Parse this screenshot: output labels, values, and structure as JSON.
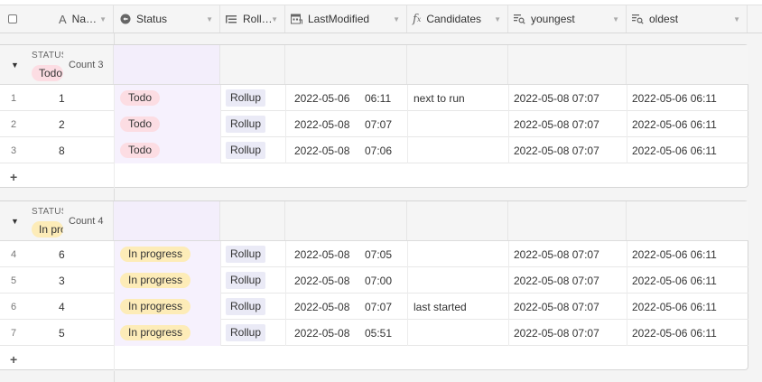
{
  "colors": {
    "todo": "#fcdde3",
    "in_progress": "#fdecb8",
    "rollup_bg": "#eaeaf6",
    "status_col_bg": "#f6f1fd"
  },
  "columns": [
    {
      "label": "Na…",
      "icon": "text-icon"
    },
    {
      "label": "Status",
      "icon": "status-icon"
    },
    {
      "label": "Roll…",
      "icon": "rollup-icon"
    },
    {
      "label": "LastModified",
      "icon": "calendar-icon"
    },
    {
      "label": "Candidates",
      "icon": "formula-icon"
    },
    {
      "label": "youngest",
      "icon": "lookup-icon"
    },
    {
      "label": "oldest",
      "icon": "lookup-icon"
    }
  ],
  "groups": [
    {
      "field_label": "STATUS",
      "value": "Todo",
      "count": "Count 3",
      "rows": [
        {
          "num": "1",
          "name": "1",
          "status": "Todo",
          "rollup": "Rollup",
          "date": "2022-05-06",
          "time": "06:11",
          "candidates": "next to run",
          "youngest": "2022-05-08 07:07",
          "oldest": "2022-05-06 06:11"
        },
        {
          "num": "2",
          "name": "2",
          "status": "Todo",
          "rollup": "Rollup",
          "date": "2022-05-08",
          "time": "07:07",
          "candidates": "",
          "youngest": "2022-05-08 07:07",
          "oldest": "2022-05-06 06:11"
        },
        {
          "num": "3",
          "name": "8",
          "status": "Todo",
          "rollup": "Rollup",
          "date": "2022-05-08",
          "time": "07:06",
          "candidates": "",
          "youngest": "2022-05-08 07:07",
          "oldest": "2022-05-06 06:11"
        }
      ]
    },
    {
      "field_label": "STATUS",
      "value": "In progress",
      "count": "Count 4",
      "rows": [
        {
          "num": "4",
          "name": "6",
          "status": "In progress",
          "rollup": "Rollup",
          "date": "2022-05-08",
          "time": "07:05",
          "candidates": "",
          "youngest": "2022-05-08 07:07",
          "oldest": "2022-05-06 06:11"
        },
        {
          "num": "5",
          "name": "3",
          "status": "In progress",
          "rollup": "Rollup",
          "date": "2022-05-08",
          "time": "07:00",
          "candidates": "",
          "youngest": "2022-05-08 07:07",
          "oldest": "2022-05-06 06:11"
        },
        {
          "num": "6",
          "name": "4",
          "status": "In progress",
          "rollup": "Rollup",
          "date": "2022-05-08",
          "time": "07:07",
          "candidates": "last started",
          "youngest": "2022-05-08 07:07",
          "oldest": "2022-05-06 06:11"
        },
        {
          "num": "7",
          "name": "5",
          "status": "In progress",
          "rollup": "Rollup",
          "date": "2022-05-08",
          "time": "05:51",
          "candidates": "",
          "youngest": "2022-05-08 07:07",
          "oldest": "2022-05-06 06:11"
        }
      ]
    }
  ],
  "add_row_label": "+"
}
